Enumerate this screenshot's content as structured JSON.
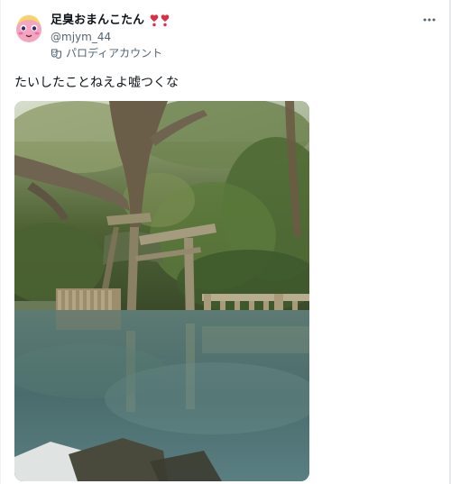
{
  "tweet": {
    "author": {
      "display_name": "足臭おまんこたん",
      "name_suffix_icons": [
        "red-heart-exclamation-icon",
        "red-heart-exclamation-icon"
      ],
      "handle": "@mjym_44",
      "parody_label": "パロディアカウント",
      "parody_icon": "theater-mask-icon"
    },
    "text": "たいしたことねえよ嘘つくな",
    "media": {
      "icon": "photo",
      "description_icon": "torii-gate-in-pond-photo"
    },
    "more_icon": "more-dots-icon"
  },
  "colors": {
    "text_primary": "#0f1419",
    "text_secondary": "#536471",
    "heart_red": "#dd2e44",
    "avatar_pink": "#f8a7c2"
  }
}
